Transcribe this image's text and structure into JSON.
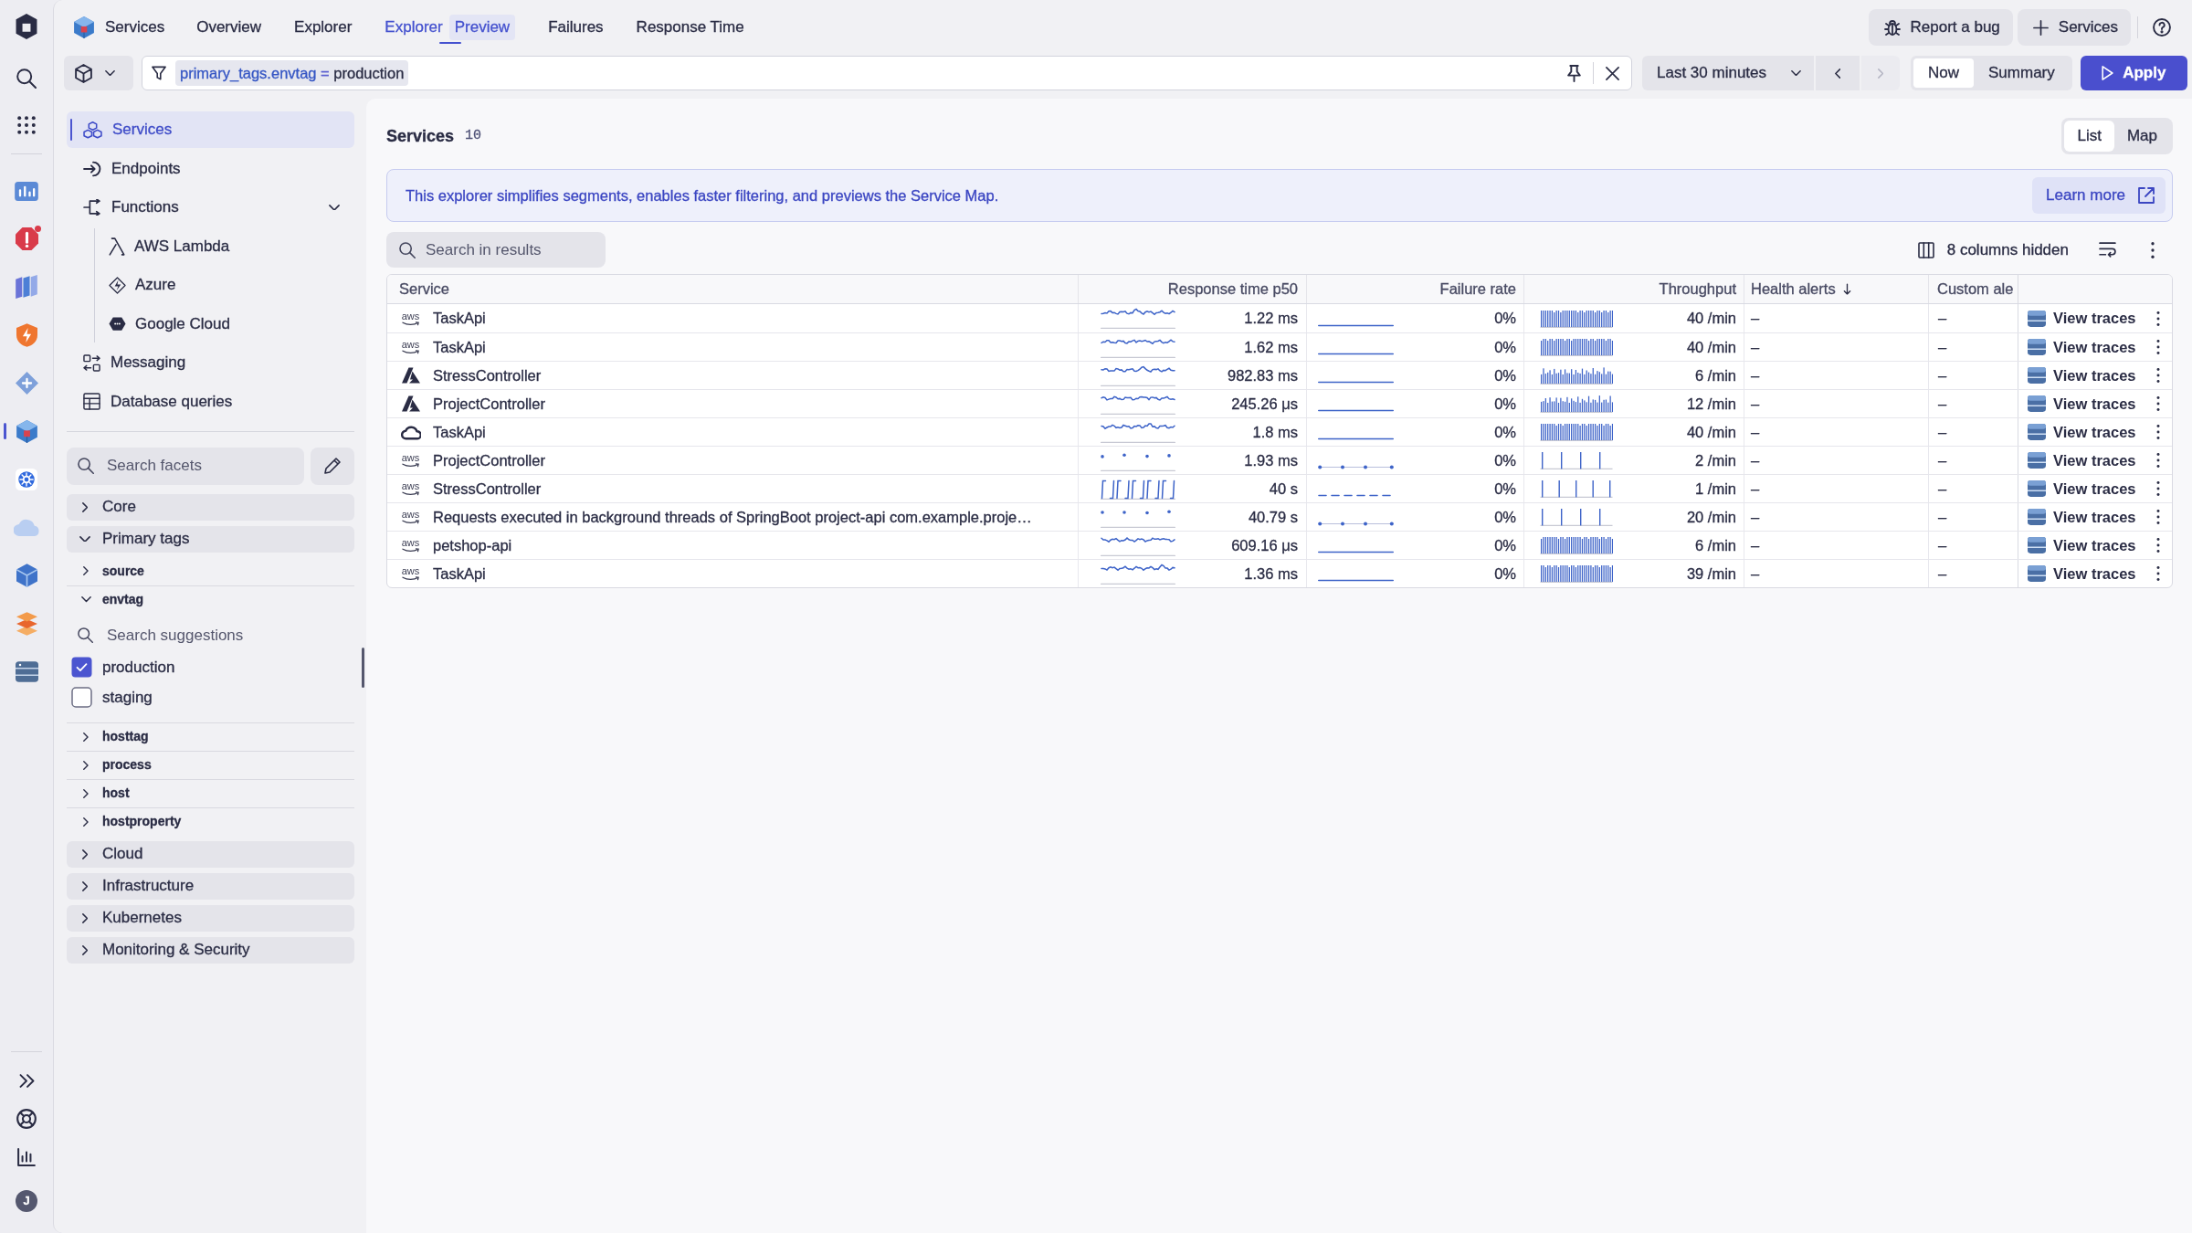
{
  "rail": {
    "apps": [
      {
        "selected": false,
        "notification": false
      },
      {
        "selected": false,
        "notification": true
      },
      {
        "selected": false,
        "notification": false
      },
      {
        "selected": false,
        "notification": false
      },
      {
        "selected": false,
        "notification": false
      },
      {
        "selected": true,
        "notification": false
      },
      {
        "selected": false,
        "notification": false
      },
      {
        "selected": false,
        "notification": false
      },
      {
        "selected": false,
        "notification": false
      },
      {
        "selected": false,
        "notification": false
      },
      {
        "selected": false,
        "notification": false
      }
    ],
    "user": {
      "initial": "J"
    }
  },
  "header": {
    "app_title": "Services",
    "tabs": [
      {
        "label": "Overview",
        "selected": false
      },
      {
        "label": "Explorer",
        "selected": false
      },
      {
        "label": "Explorer",
        "badge": "Preview",
        "selected": true
      },
      {
        "label": "Failures",
        "selected": false
      },
      {
        "label": "Response Time",
        "selected": false
      }
    ],
    "actions": [
      {
        "kind": "bug",
        "label": "Report a bug"
      },
      {
        "kind": "add",
        "label": "Services"
      }
    ]
  },
  "filter_bar": {
    "filter": {
      "key": "primary_tags.envtag",
      "operator": "=",
      "value": "production"
    },
    "timeframe": "Last 30 minutes",
    "next_disabled": true,
    "modes": [
      {
        "label": "Now",
        "selected": true
      },
      {
        "label": "Summary",
        "selected": false
      }
    ],
    "apply": "Apply"
  },
  "sidebar": {
    "nav": [
      {
        "label": "Services",
        "selected": true
      },
      {
        "label": "Endpoints",
        "selected": false
      },
      {
        "label": "Functions",
        "selected": false,
        "expanded": true,
        "children": [
          {
            "label": "AWS Lambda",
            "selected": false
          },
          {
            "label": "Azure",
            "selected": false
          },
          {
            "label": "Google Cloud",
            "selected": false
          }
        ]
      },
      {
        "label": "Messaging",
        "selected": false
      },
      {
        "label": "Database queries",
        "selected": false
      }
    ],
    "facet_search": {
      "placeholder": "Search facets"
    },
    "facet_groups": [
      {
        "label": "Core",
        "expanded": false
      },
      {
        "label": "Primary tags",
        "expanded": true,
        "children": [
          {
            "label": "source",
            "expanded": false
          },
          {
            "label": "envtag",
            "expanded": true,
            "search": {
              "placeholder": "Search suggestions"
            },
            "options": [
              {
                "label": "production",
                "checked": true
              },
              {
                "label": "staging",
                "checked": false
              }
            ]
          },
          {
            "label": "hosttag",
            "expanded": false
          },
          {
            "label": "process",
            "expanded": false
          },
          {
            "label": "host",
            "expanded": false
          },
          {
            "label": "hostproperty",
            "expanded": false
          }
        ]
      },
      {
        "label": "Cloud",
        "expanded": false
      },
      {
        "label": "Infrastructure",
        "expanded": false
      },
      {
        "label": "Kubernetes",
        "expanded": false
      },
      {
        "label": "Monitoring & Security",
        "expanded": false
      }
    ]
  },
  "main": {
    "title": "Services",
    "count": "10",
    "views": [
      {
        "label": "List",
        "selected": true
      },
      {
        "label": "Map",
        "selected": false
      }
    ],
    "banner": {
      "text": "This explorer simplifies segments, enables faster filtering, and previews the Service Map.",
      "link": "Learn more"
    },
    "search": {
      "placeholder": "Search in results"
    },
    "hidden_columns": "8 columns hidden",
    "table": {
      "columns": [
        {
          "label": "Service",
          "sorted": false
        },
        {
          "label": "Response time p50",
          "sorted": false
        },
        {
          "label": "Failure rate",
          "sorted": false
        },
        {
          "label": "Throughput",
          "sorted": false
        },
        {
          "label": "Health alerts",
          "sorted": true
        },
        {
          "label": "Custom ale",
          "sorted": false
        }
      ],
      "rows": [
        {
          "logo": {
            "kind": "aws",
            "text": "aws"
          },
          "service": "TaskApi",
          "response_sparkline": {
            "kind": "line"
          },
          "response_time": "1.22 ms",
          "failure_sparkline": {
            "kind": "flat"
          },
          "failure_rate": "0%",
          "throughput_sparkline": {
            "kind": "dense"
          },
          "throughput": "40 /min",
          "health_alerts": "–",
          "column_6": "–",
          "action": "View traces"
        },
        {
          "logo": {
            "kind": "aws",
            "text": "aws"
          },
          "service": "TaskApi",
          "response_sparkline": {
            "kind": "line"
          },
          "response_time": "1.62 ms",
          "failure_sparkline": {
            "kind": "flat"
          },
          "failure_rate": "0%",
          "throughput_sparkline": {
            "kind": "dense"
          },
          "throughput": "40 /min",
          "health_alerts": "–",
          "column_6": "–",
          "action": "View traces"
        },
        {
          "logo": {
            "kind": "azure"
          },
          "service": "StressController",
          "response_sparkline": {
            "kind": "line"
          },
          "response_time": "982.83 ms",
          "failure_sparkline": {
            "kind": "flat"
          },
          "failure_rate": "0%",
          "throughput_sparkline": {
            "kind": "uneven"
          },
          "throughput": "6 /min",
          "health_alerts": "–",
          "column_6": "–",
          "action": "View traces"
        },
        {
          "logo": {
            "kind": "azure"
          },
          "service": "ProjectController",
          "response_sparkline": {
            "kind": "line"
          },
          "response_time": "245.26 μs",
          "failure_sparkline": {
            "kind": "flat"
          },
          "failure_rate": "0%",
          "throughput_sparkline": {
            "kind": "uneven"
          },
          "throughput": "12 /min",
          "health_alerts": "–",
          "column_6": "–",
          "action": "View traces"
        },
        {
          "logo": {
            "kind": "gcp"
          },
          "service": "TaskApi",
          "response_sparkline": {
            "kind": "line"
          },
          "response_time": "1.8 ms",
          "failure_sparkline": {
            "kind": "flat"
          },
          "failure_rate": "0%",
          "throughput_sparkline": {
            "kind": "dense"
          },
          "throughput": "40 /min",
          "health_alerts": "–",
          "column_6": "–",
          "action": "View traces"
        },
        {
          "logo": {
            "kind": "aws",
            "text": "aws"
          },
          "service": "ProjectController",
          "response_sparkline": {
            "kind": "dots"
          },
          "response_time": "1.93 ms",
          "failure_sparkline": {
            "kind": "dotted"
          },
          "failure_rate": "0%",
          "throughput_sparkline": {
            "kind": "sparse"
          },
          "throughput": "2 /min",
          "health_alerts": "–",
          "column_6": "–",
          "action": "View traces"
        },
        {
          "logo": {
            "kind": "aws",
            "text": "aws"
          },
          "service": "StressController",
          "response_sparkline": {
            "kind": "pulses"
          },
          "response_time": "40 s",
          "failure_sparkline": {
            "kind": "dashed"
          },
          "failure_rate": "0%",
          "throughput_sparkline": {
            "kind": "sparse"
          },
          "throughput": "1 /min",
          "health_alerts": "–",
          "column_6": "–",
          "action": "View traces"
        },
        {
          "logo": {
            "kind": "aws",
            "text": "aws"
          },
          "service": "Requests executed in background threads of SpringBoot project-api com.example.proje…",
          "response_sparkline": {
            "kind": "dots"
          },
          "response_time": "40.79 s",
          "failure_sparkline": {
            "kind": "dotted"
          },
          "failure_rate": "0%",
          "throughput_sparkline": {
            "kind": "sparse"
          },
          "throughput": "20 /min",
          "health_alerts": "–",
          "column_6": "–",
          "action": "View traces"
        },
        {
          "logo": {
            "kind": "aws",
            "text": "aws"
          },
          "service": "petshop-api",
          "response_sparkline": {
            "kind": "line"
          },
          "response_time": "609.16 μs",
          "failure_sparkline": {
            "kind": "flat"
          },
          "failure_rate": "0%",
          "throughput_sparkline": {
            "kind": "dense"
          },
          "throughput": "6 /min",
          "health_alerts": "–",
          "column_6": "–",
          "action": "View traces"
        },
        {
          "logo": {
            "kind": "aws",
            "text": "aws"
          },
          "service": "TaskApi",
          "response_sparkline": {
            "kind": "line"
          },
          "response_time": "1.36 ms",
          "failure_sparkline": {
            "kind": "flat"
          },
          "failure_rate": "0%",
          "throughput_sparkline": {
            "kind": "dense"
          },
          "throughput": "39 /min",
          "health_alerts": "–",
          "column_6": "–",
          "action": "View traces"
        }
      ]
    }
  }
}
